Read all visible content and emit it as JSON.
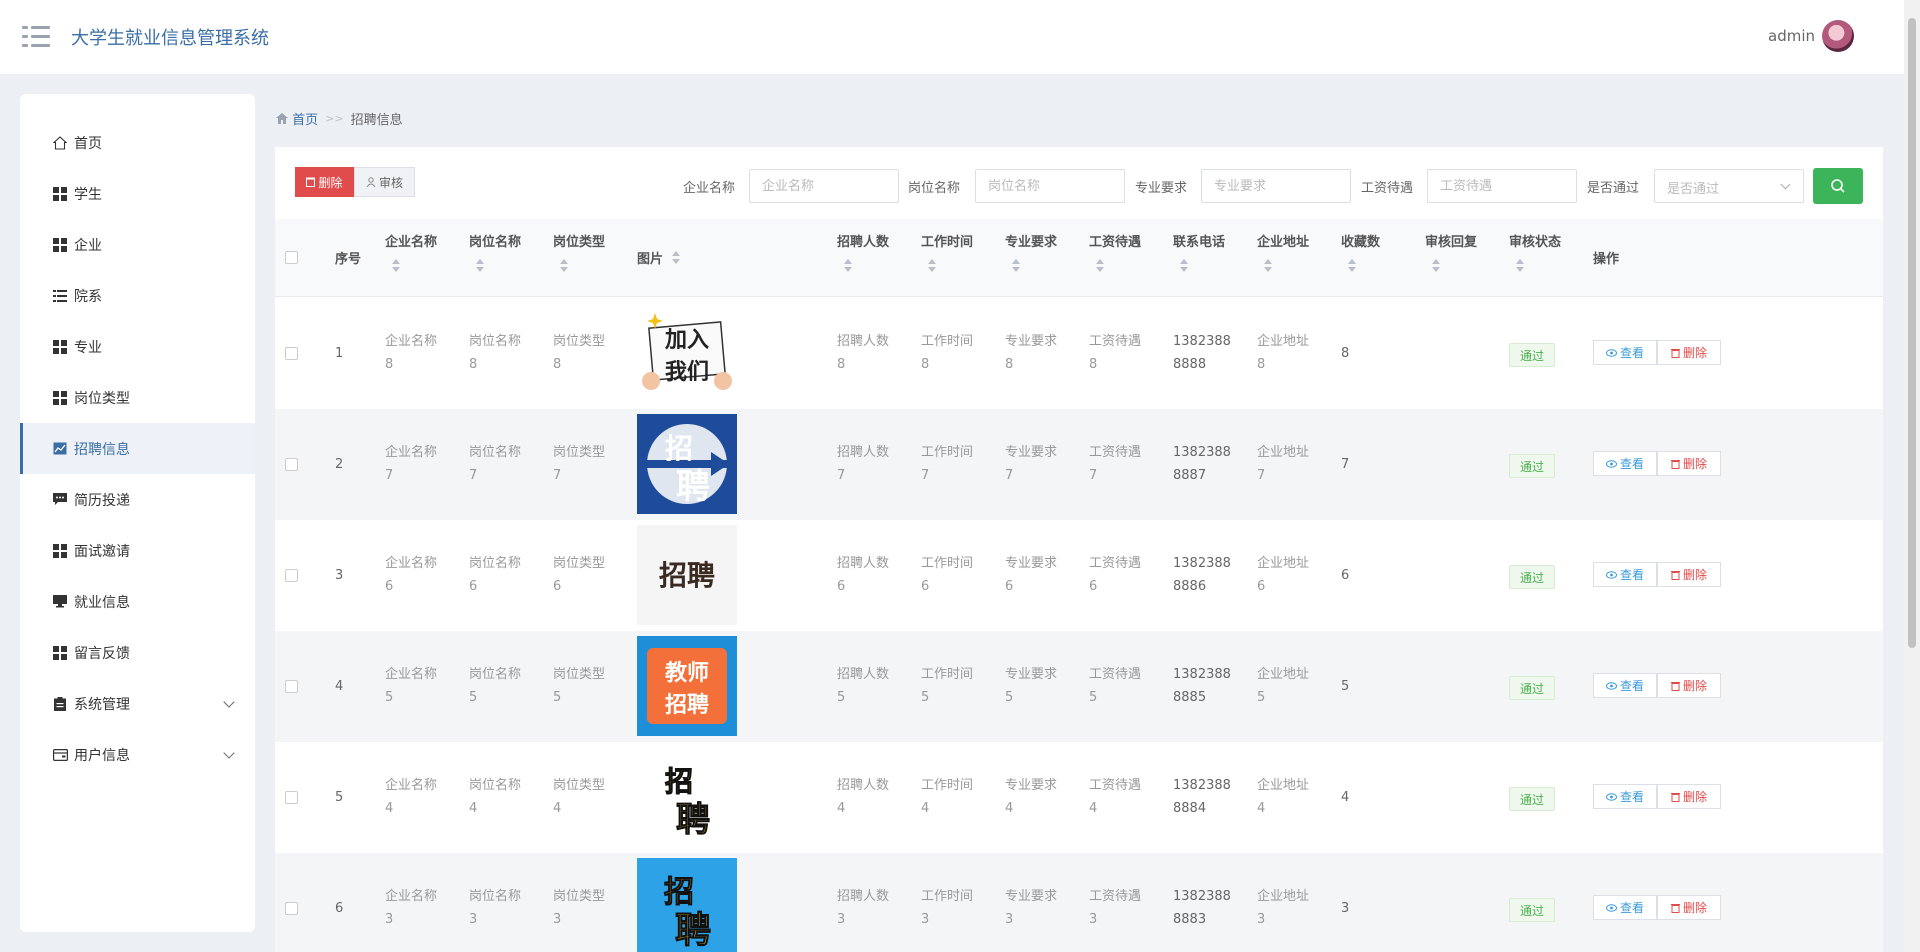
{
  "header": {
    "title": "大学生就业信息管理系统",
    "user": "admin"
  },
  "sidebar": {
    "items": [
      {
        "label": "首页",
        "icon": "home-icon"
      },
      {
        "label": "学生",
        "icon": "grid-icon"
      },
      {
        "label": "企业",
        "icon": "grid-icon"
      },
      {
        "label": "院系",
        "icon": "list-icon"
      },
      {
        "label": "专业",
        "icon": "grid-icon"
      },
      {
        "label": "岗位类型",
        "icon": "grid-icon"
      },
      {
        "label": "招聘信息",
        "icon": "chart-icon",
        "active": true
      },
      {
        "label": "简历投递",
        "icon": "chat-icon"
      },
      {
        "label": "面试邀请",
        "icon": "grid-icon"
      },
      {
        "label": "就业信息",
        "icon": "monitor-icon"
      },
      {
        "label": "留言反馈",
        "icon": "grid-icon"
      },
      {
        "label": "系统管理",
        "icon": "clipboard-icon",
        "expandable": true
      },
      {
        "label": "用户信息",
        "icon": "card-icon",
        "expandable": true
      }
    ]
  },
  "breadcrumb": {
    "home": "首页",
    "sep": ">>",
    "current": "招聘信息"
  },
  "toolbar": {
    "delete_label": "删除",
    "audit_label": "审核"
  },
  "filters": {
    "company": {
      "label": "企业名称",
      "placeholder": "企业名称"
    },
    "position": {
      "label": "岗位名称",
      "placeholder": "岗位名称"
    },
    "major": {
      "label": "专业要求",
      "placeholder": "专业要求"
    },
    "salary": {
      "label": "工资待遇",
      "placeholder": "工资待遇"
    },
    "passed": {
      "label": "是否通过",
      "placeholder": "是否通过"
    }
  },
  "table": {
    "headers": {
      "index": "序号",
      "company": "企业名称",
      "position": "岗位名称",
      "type": "岗位类型",
      "image": "图片",
      "count": "招聘人数",
      "time": "工作时间",
      "major": "专业要求",
      "salary": "工资待遇",
      "phone": "联系电话",
      "address": "企业地址",
      "fav": "收藏数",
      "reply": "审核回复",
      "status": "审核状态",
      "action": "操作"
    },
    "view_label": "查看",
    "remove_label": "删除",
    "rows": [
      {
        "index": "1",
        "company": [
          "企业名称",
          "8"
        ],
        "position": [
          "岗位名称",
          "8"
        ],
        "type": [
          "岗位类型",
          "8"
        ],
        "count": [
          "招聘人数",
          "8"
        ],
        "time": [
          "工作时间",
          "8"
        ],
        "major": [
          "专业要求",
          "8"
        ],
        "salary": [
          "工资待遇",
          "8"
        ],
        "phone": [
          "1382388",
          "8888"
        ],
        "address": [
          "企业地址",
          "8"
        ],
        "fav": "8",
        "status": "通过",
        "pic": "加入我们"
      },
      {
        "index": "2",
        "company": [
          "企业名称",
          "7"
        ],
        "position": [
          "岗位名称",
          "7"
        ],
        "type": [
          "岗位类型",
          "7"
        ],
        "count": [
          "招聘人数",
          "7"
        ],
        "time": [
          "工作时间",
          "7"
        ],
        "major": [
          "专业要求",
          "7"
        ],
        "salary": [
          "工资待遇",
          "7"
        ],
        "phone": [
          "1382388",
          "8887"
        ],
        "address": [
          "企业地址",
          "7"
        ],
        "fav": "7",
        "status": "通过",
        "pic": "招聘"
      },
      {
        "index": "3",
        "company": [
          "企业名称",
          "6"
        ],
        "position": [
          "岗位名称",
          "6"
        ],
        "type": [
          "岗位类型",
          "6"
        ],
        "count": [
          "招聘人数",
          "6"
        ],
        "time": [
          "工作时间",
          "6"
        ],
        "major": [
          "专业要求",
          "6"
        ],
        "salary": [
          "工资待遇",
          "6"
        ],
        "phone": [
          "1382388",
          "8886"
        ],
        "address": [
          "企业地址",
          "6"
        ],
        "fav": "6",
        "status": "通过",
        "pic": "招聘"
      },
      {
        "index": "4",
        "company": [
          "企业名称",
          "5"
        ],
        "position": [
          "岗位名称",
          "5"
        ],
        "type": [
          "岗位类型",
          "5"
        ],
        "count": [
          "招聘人数",
          "5"
        ],
        "time": [
          "工作时间",
          "5"
        ],
        "major": [
          "专业要求",
          "5"
        ],
        "salary": [
          "工资待遇",
          "5"
        ],
        "phone": [
          "1382388",
          "8885"
        ],
        "address": [
          "企业地址",
          "5"
        ],
        "fav": "5",
        "status": "通过",
        "pic": "教师招聘"
      },
      {
        "index": "5",
        "company": [
          "企业名称",
          "4"
        ],
        "position": [
          "岗位名称",
          "4"
        ],
        "type": [
          "岗位类型",
          "4"
        ],
        "count": [
          "招聘人数",
          "4"
        ],
        "time": [
          "工作时间",
          "4"
        ],
        "major": [
          "专业要求",
          "4"
        ],
        "salary": [
          "工资待遇",
          "4"
        ],
        "phone": [
          "1382388",
          "8884"
        ],
        "address": [
          "企业地址",
          "4"
        ],
        "fav": "4",
        "status": "通过",
        "pic": "招聘"
      },
      {
        "index": "6",
        "company": [
          "企业名称",
          "3"
        ],
        "position": [
          "岗位名称",
          "3"
        ],
        "type": [
          "岗位类型",
          "3"
        ],
        "count": [
          "招聘人数",
          "3"
        ],
        "time": [
          "工作时间",
          "3"
        ],
        "major": [
          "专业要求",
          "3"
        ],
        "salary": [
          "工资待遇",
          "3"
        ],
        "phone": [
          "1382388",
          "8883"
        ],
        "address": [
          "企业地址",
          "3"
        ],
        "fav": "3",
        "status": "通过",
        "pic": "招聘"
      }
    ]
  },
  "colors": {
    "accent": "#3a6ea5",
    "danger": "#e04b4b",
    "success": "#3cb55a"
  }
}
